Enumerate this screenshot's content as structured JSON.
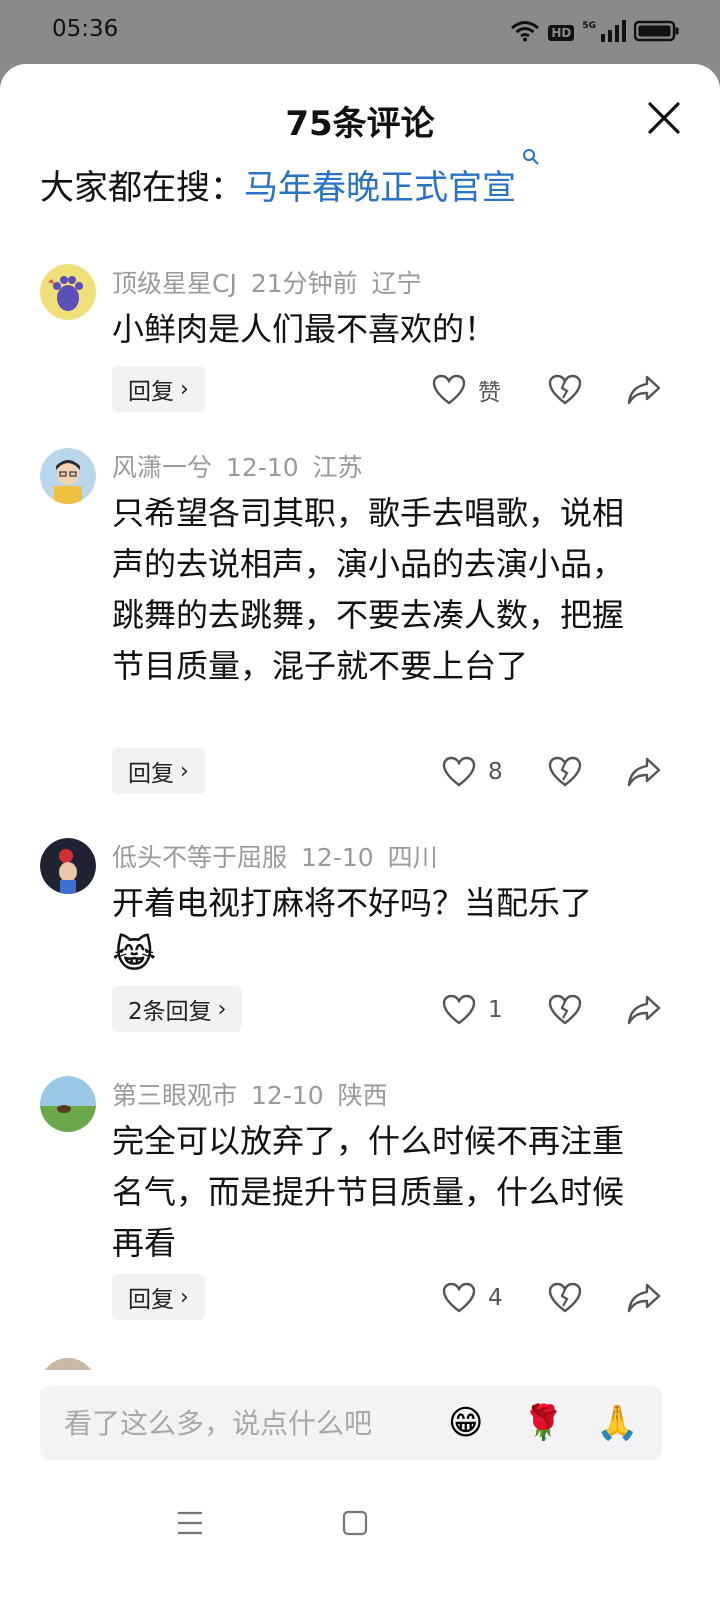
{
  "status_bar": {
    "time": "05:36",
    "hd_label": "HD",
    "network_label": "5G"
  },
  "sheet": {
    "title": "75条评论",
    "search_prefix": "大家都在搜：",
    "search_query": "马年春晚正式官宣",
    "close_icon": "close-icon"
  },
  "comments": [
    {
      "user": "顶级星星CJ",
      "time": "21分钟前",
      "location": "辽宁",
      "text": "小鲜肉是人们最不喜欢的！",
      "reply_label": "回复",
      "like_label": "赞"
    },
    {
      "user": "风潇一兮",
      "time": "12-10",
      "location": "江苏",
      "text": "只希望各司其职，歌手去唱歌，说相声的去说相声，演小品的去演小品，跳舞的去跳舞，不要去凑人数，把握节目质量，混子就不要上台了",
      "reply_label": "回复",
      "like_label": "8"
    },
    {
      "user": "低头不等于屈服",
      "time": "12-10",
      "location": "四川",
      "text": "开着电视打麻将不好吗？当配乐了",
      "emoji": "😹",
      "reply_label": "2条回复",
      "like_label": "1"
    },
    {
      "user": "第三眼观市",
      "time": "12-10",
      "location": "陕西",
      "text": "完全可以放弃了，什么时候不再注重名气，而是提升节目质量，什么时候再看",
      "reply_label": "回复",
      "like_label": "4"
    }
  ],
  "input": {
    "placeholder": "看了这么多，说点什么吧",
    "emojis": [
      "😁",
      "🌹",
      "🙏"
    ]
  },
  "colors": {
    "link": "#2a72c6",
    "meta": "#9a9a9a",
    "sheet_bg": "#ffffff",
    "status_bg": "#8a8a8a"
  }
}
